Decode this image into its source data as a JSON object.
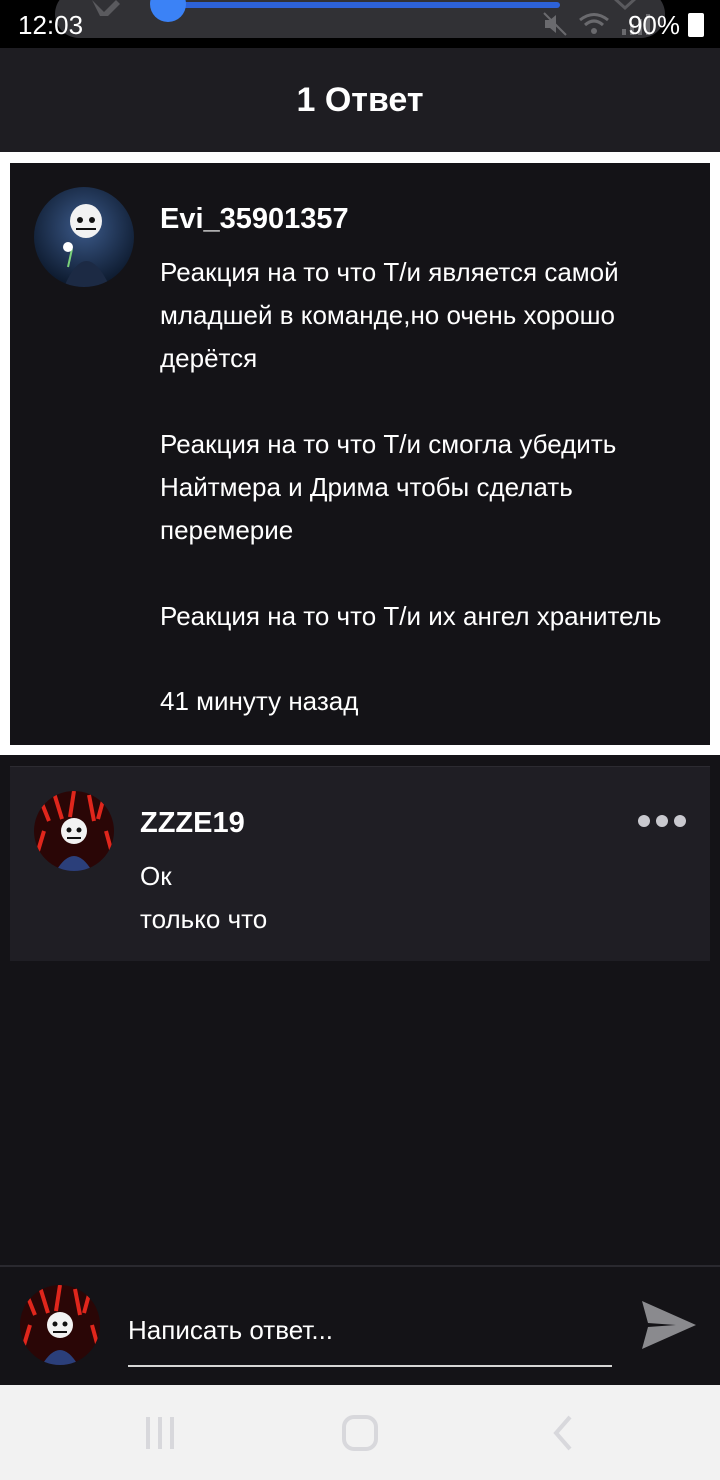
{
  "status_bar": {
    "time": "12:03",
    "battery": "90%"
  },
  "header": {
    "title": "1 Ответ"
  },
  "parent_comment": {
    "username": "Evi_35901357",
    "paragraphs": [
      "Реакция на то что Т/и является самой младшей в команде,но очень хорошо дерётся",
      "Реакция на то что Т/и смогла убедить Найтмера и Дрима чтобы сделать перемерие",
      "Реакция на то что Т/и их ангел хранитель"
    ],
    "timestamp": "41 минуту назад"
  },
  "reply": {
    "username": "ZZZE19",
    "text": "Ок",
    "timestamp": "только что"
  },
  "composer": {
    "placeholder": "Написать ответ..."
  },
  "icons": {
    "send": "send-icon",
    "more": "more-dots-icon",
    "nav_recents": "recents-icon",
    "nav_home": "home-icon",
    "nav_back": "back-icon"
  },
  "colors": {
    "background": "#141317",
    "card": "#1f1e24",
    "header": "#1e1d22",
    "accent_blue": "#3b82f6"
  }
}
